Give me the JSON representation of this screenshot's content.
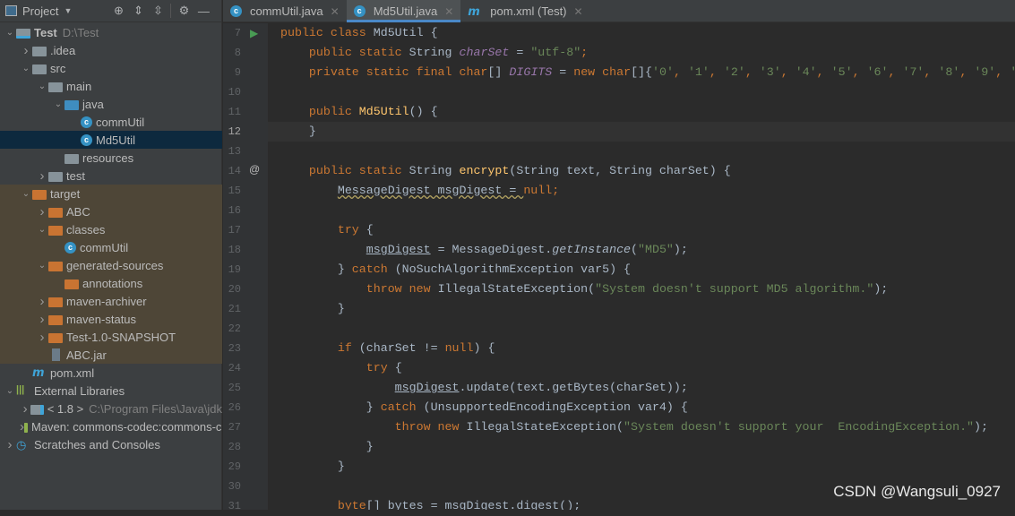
{
  "sidebar": {
    "title": "Project",
    "items": [
      {
        "level": 0,
        "arrow": "down",
        "icon": "module",
        "label": "Test",
        "hint": "D:\\Test",
        "bold": true
      },
      {
        "level": 1,
        "arrow": "right",
        "icon": "folder",
        "label": ".idea"
      },
      {
        "level": 1,
        "arrow": "down",
        "icon": "folder",
        "label": "src"
      },
      {
        "level": 2,
        "arrow": "down",
        "icon": "folder",
        "label": "main"
      },
      {
        "level": 3,
        "arrow": "down",
        "icon": "folder-blue",
        "label": "java"
      },
      {
        "level": 4,
        "arrow": "",
        "icon": "class",
        "label": "commUtil"
      },
      {
        "level": 4,
        "arrow": "",
        "icon": "class",
        "label": "Md5Util",
        "selected": true
      },
      {
        "level": 3,
        "arrow": "",
        "icon": "folder",
        "label": "resources"
      },
      {
        "level": 2,
        "arrow": "right",
        "icon": "folder",
        "label": "test"
      },
      {
        "level": 1,
        "arrow": "down",
        "icon": "folder-orange",
        "label": "target",
        "target": true
      },
      {
        "level": 2,
        "arrow": "right",
        "icon": "folder-orange",
        "label": "ABC",
        "target": true
      },
      {
        "level": 2,
        "arrow": "down",
        "icon": "folder-orange",
        "label": "classes",
        "target": true
      },
      {
        "level": 3,
        "arrow": "",
        "icon": "class",
        "label": "commUtil",
        "target": true
      },
      {
        "level": 2,
        "arrow": "down",
        "icon": "folder-orange",
        "label": "generated-sources",
        "target": true
      },
      {
        "level": 3,
        "arrow": "",
        "icon": "folder-orange",
        "label": "annotations",
        "target": true
      },
      {
        "level": 2,
        "arrow": "right",
        "icon": "folder-orange",
        "label": "maven-archiver",
        "target": true
      },
      {
        "level": 2,
        "arrow": "right",
        "icon": "folder-orange",
        "label": "maven-status",
        "target": true
      },
      {
        "level": 2,
        "arrow": "right",
        "icon": "folder-orange",
        "label": "Test-1.0-SNAPSHOT",
        "target": true
      },
      {
        "level": 2,
        "arrow": "",
        "icon": "jar",
        "label": "ABC.jar",
        "target": true
      },
      {
        "level": 1,
        "arrow": "",
        "icon": "maven",
        "label": "pom.xml"
      },
      {
        "level": 0,
        "arrow": "down",
        "icon": "libraries",
        "label": "External Libraries"
      },
      {
        "level": 1,
        "arrow": "right",
        "icon": "jdk",
        "label": "< 1.8 >",
        "hint": "C:\\Program Files\\Java\\jdk"
      },
      {
        "level": 1,
        "arrow": "right",
        "icon": "library",
        "label": "Maven: commons-codec:commons-codec"
      },
      {
        "level": 0,
        "arrow": "right",
        "icon": "scratches",
        "label": "Scratches and Consoles"
      }
    ]
  },
  "tabs": [
    {
      "label": "commUtil.java",
      "icon": "class"
    },
    {
      "label": "Md5Util.java",
      "icon": "class",
      "active": true
    },
    {
      "label": "pom.xml (Test)",
      "icon": "maven"
    }
  ],
  "editor": {
    "current_line": 12,
    "lines": [
      {
        "n": 7,
        "t": [
          [
            "kw",
            "public class "
          ],
          [
            "",
            "Md5Util {"
          ]
        ]
      },
      {
        "n": 8,
        "t": [
          [
            "",
            "    "
          ],
          [
            "kw",
            "public static "
          ],
          [
            "",
            "String "
          ],
          [
            "fld",
            "charSet"
          ],
          [
            "",
            " = "
          ],
          [
            "st",
            "\"utf-8\""
          ],
          [
            "kw",
            ";"
          ]
        ]
      },
      {
        "n": 9,
        "t": [
          [
            "",
            "    "
          ],
          [
            "kw",
            "private static final char"
          ],
          [
            "",
            "[] "
          ],
          [
            "fld",
            "DIGITS"
          ],
          [
            "",
            " = "
          ],
          [
            "kw",
            "new char"
          ],
          [
            "",
            "[]{"
          ],
          [
            "st",
            "'0'"
          ],
          [
            "kw",
            ", "
          ],
          [
            "st",
            "'1'"
          ],
          [
            "kw",
            ", "
          ],
          [
            "st",
            "'2'"
          ],
          [
            "kw",
            ", "
          ],
          [
            "st",
            "'3'"
          ],
          [
            "kw",
            ", "
          ],
          [
            "st",
            "'4'"
          ],
          [
            "kw",
            ", "
          ],
          [
            "st",
            "'5'"
          ],
          [
            "kw",
            ", "
          ],
          [
            "st",
            "'6'"
          ],
          [
            "kw",
            ", "
          ],
          [
            "st",
            "'7'"
          ],
          [
            "kw",
            ", "
          ],
          [
            "st",
            "'8'"
          ],
          [
            "kw",
            ", "
          ],
          [
            "st",
            "'9'"
          ],
          [
            "kw",
            ", "
          ],
          [
            "st",
            "'a'"
          ]
        ]
      },
      {
        "n": 10,
        "t": []
      },
      {
        "n": 11,
        "t": [
          [
            "",
            "    "
          ],
          [
            "kw",
            "public "
          ],
          [
            "fn",
            "Md5Util"
          ],
          [
            "",
            "() {"
          ]
        ]
      },
      {
        "n": 12,
        "t": [
          [
            "",
            "    }"
          ]
        ]
      },
      {
        "n": 13,
        "t": []
      },
      {
        "n": 14,
        "t": [
          [
            "",
            "    "
          ],
          [
            "kw",
            "public static "
          ],
          [
            "",
            "String "
          ],
          [
            "fn",
            "encrypt"
          ],
          [
            "",
            "(String text, String charSet) {"
          ]
        ]
      },
      {
        "n": 15,
        "t": [
          [
            "",
            "        "
          ],
          [
            "wv",
            "MessageDigest msgDigest = "
          ],
          [
            "kw",
            "null"
          ],
          [
            "kw",
            ";"
          ]
        ]
      },
      {
        "n": 16,
        "t": []
      },
      {
        "n": 17,
        "t": [
          [
            "",
            "        "
          ],
          [
            "kw",
            "try "
          ],
          [
            "",
            "{"
          ]
        ]
      },
      {
        "n": 18,
        "t": [
          [
            "",
            "            "
          ],
          [
            "var",
            "msgDigest"
          ],
          [
            "",
            " = MessageDigest."
          ],
          [
            "it",
            "getInstance"
          ],
          [
            "",
            "("
          ],
          [
            "st",
            "\"MD5\""
          ],
          [
            "",
            "); "
          ]
        ]
      },
      {
        "n": 19,
        "t": [
          [
            "",
            "        } "
          ],
          [
            "kw",
            "catch "
          ],
          [
            "",
            "(NoSuchAlgorithmException var5) {"
          ]
        ]
      },
      {
        "n": 20,
        "t": [
          [
            "",
            "            "
          ],
          [
            "kw",
            "throw new "
          ],
          [
            "",
            "IllegalStateException("
          ],
          [
            "st",
            "\"System doesn't support MD5 algorithm.\""
          ],
          [
            "",
            "); "
          ]
        ]
      },
      {
        "n": 21,
        "t": [
          [
            "",
            "        }"
          ]
        ]
      },
      {
        "n": 22,
        "t": []
      },
      {
        "n": 23,
        "t": [
          [
            "",
            "        "
          ],
          [
            "kw",
            "if "
          ],
          [
            "",
            "(charSet != "
          ],
          [
            "kw",
            "null"
          ],
          [
            "",
            ") {"
          ]
        ]
      },
      {
        "n": 24,
        "t": [
          [
            "",
            "            "
          ],
          [
            "kw",
            "try "
          ],
          [
            "",
            "{"
          ]
        ]
      },
      {
        "n": 25,
        "t": [
          [
            "",
            "                "
          ],
          [
            "var",
            "msgDigest"
          ],
          [
            "",
            ".update(text.getBytes(charSet));"
          ]
        ]
      },
      {
        "n": 26,
        "t": [
          [
            "",
            "            } "
          ],
          [
            "kw",
            "catch "
          ],
          [
            "",
            "(UnsupportedEncodingException var4) {"
          ]
        ]
      },
      {
        "n": 27,
        "t": [
          [
            "",
            "                "
          ],
          [
            "kw",
            "throw new "
          ],
          [
            "",
            "IllegalStateException("
          ],
          [
            "st",
            "\"System doesn't support your  EncodingException.\""
          ],
          [
            "",
            "); "
          ]
        ]
      },
      {
        "n": 28,
        "t": [
          [
            "",
            "            }"
          ]
        ]
      },
      {
        "n": 29,
        "t": [
          [
            "",
            "        }"
          ]
        ]
      },
      {
        "n": 30,
        "t": []
      },
      {
        "n": 31,
        "t": [
          [
            "",
            "        "
          ],
          [
            "kw",
            "byte"
          ],
          [
            "",
            "[] bytes = "
          ],
          [
            "var",
            "msgDigest"
          ],
          [
            "",
            ".digest();"
          ]
        ]
      }
    ]
  },
  "watermark": "CSDN @Wangsuli_0927"
}
